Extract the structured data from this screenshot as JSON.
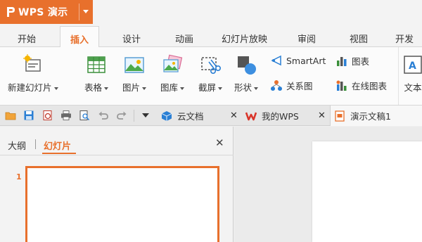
{
  "app": {
    "name": "WPS 演示",
    "logo_glyph": "P",
    "accent_color": "#e8702c"
  },
  "tabs": [
    {
      "label": "开始"
    },
    {
      "label": "插入",
      "active": true
    },
    {
      "label": "设计"
    },
    {
      "label": "动画"
    },
    {
      "label": "幻灯片放映"
    },
    {
      "label": "审阅"
    },
    {
      "label": "视图"
    },
    {
      "label": "开发工"
    }
  ],
  "ribbon": {
    "new_slide": "新建幻灯片",
    "table": "表格",
    "picture": "图片",
    "gallery": "图库",
    "screenshot": "截屏",
    "shapes": "形状",
    "smartart": "SmartArt",
    "chart": "图表",
    "relationship": "关系图",
    "online_chart": "在线图表",
    "text": "文本"
  },
  "quick_access": {
    "icons": [
      "open-folder-icon",
      "save-icon",
      "export-pdf-icon",
      "print-icon",
      "print-preview-icon",
      "undo-icon",
      "redo-icon",
      "customize-dropdown-icon"
    ]
  },
  "doc_tabs": [
    {
      "label": "云文档",
      "icon": "cloud-cube-icon"
    },
    {
      "label": "我的WPS",
      "icon": "wps-logo-icon"
    },
    {
      "label": "演示文稿1",
      "icon": "presentation-doc-icon",
      "active": true
    }
  ],
  "left_panel": {
    "tab_outline": "大纲",
    "tab_slides": "幻灯片",
    "slide_number": "1"
  }
}
